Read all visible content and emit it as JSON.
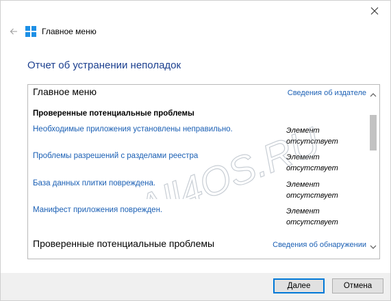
{
  "window": {
    "nav_title": "Главное меню",
    "heading": "Отчет об устранении неполадок"
  },
  "panel": {
    "section1": {
      "title": "Главное меню",
      "link": "Сведения об издателе"
    },
    "subtitle": "Проверенные потенциальные проблемы",
    "rows": [
      {
        "issue": "Необходимые приложения установлены неправильно.",
        "status_line1": "Элемент",
        "status_line2": "отсутствует"
      },
      {
        "issue": "Проблемы разрешений с разделами реестра",
        "status_line1": "Элемент",
        "status_line2": "отсутствует"
      },
      {
        "issue": "База данных плитки повреждена.",
        "status_line1": "Элемент",
        "status_line2": "отсутствует"
      },
      {
        "issue": "Манифест приложения поврежден.",
        "status_line1": "Элемент",
        "status_line2": "отсутствует"
      }
    ],
    "section2": {
      "title": "Проверенные потенциальные проблемы",
      "link": "Сведения об обнаружении"
    }
  },
  "watermark": "All4OS.RU",
  "footer": {
    "next_label_mnemonic": "Д",
    "next_label_rest": "алее",
    "cancel_label": "Отмена"
  },
  "colors": {
    "accent": "#0078d7",
    "link": "#1a5fb4",
    "heading": "#1b3f8f",
    "windows_logo": "#1e90e6"
  }
}
